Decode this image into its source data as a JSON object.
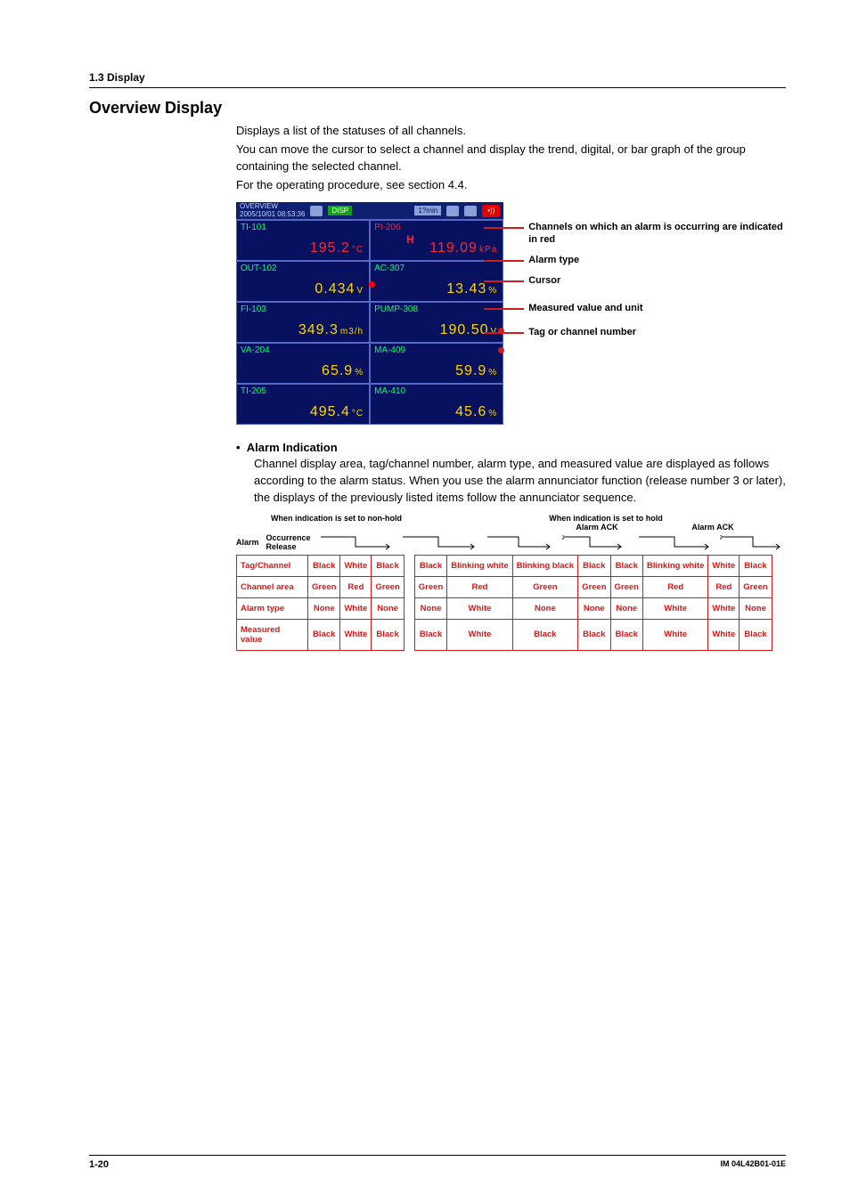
{
  "section": {
    "breadcrumb": "1.3  Display"
  },
  "heading": "Overview Display",
  "intro": {
    "l1": "Displays a list of the statuses of all channels.",
    "l2": "You can move the cursor to select a channel and display the trend, digital, or bar graph of the group containing the selected channel.",
    "l3": "For the operating procedure, see section 4.4."
  },
  "screenshot": {
    "titlebar": {
      "title": "OVERVIEW",
      "datetime": "2005/10/01 08:53:36",
      "disp": "DISP",
      "rate": "1?min"
    },
    "cells": [
      {
        "tag": "TI-101",
        "tag_color": "green",
        "val": "195.2",
        "unit": "°C",
        "val_color": "red"
      },
      {
        "tag": "PI-206",
        "tag_color": "red",
        "alarm_type": "H",
        "val": "119.09",
        "unit": "kPa",
        "val_color": "red"
      },
      {
        "tag": "OUT-102",
        "tag_color": "green",
        "val": "0.434",
        "unit": "V",
        "val_color": "yel"
      },
      {
        "tag": "AC-307",
        "tag_color": "green",
        "val": "13.43",
        "unit": "%",
        "val_color": "yel"
      },
      {
        "tag": "FI-103",
        "tag_color": "green",
        "val": "349.3",
        "unit": "m3/h",
        "val_color": "yel"
      },
      {
        "tag": "PUMP-308",
        "tag_color": "green",
        "val": "190.50",
        "unit": "V",
        "val_color": "yel"
      },
      {
        "tag": "VA-204",
        "tag_color": "green",
        "val": "65.9",
        "unit": "%",
        "val_color": "yel"
      },
      {
        "tag": "MA-409",
        "tag_color": "green",
        "val": "59.9",
        "unit": "%",
        "val_color": "yel"
      },
      {
        "tag": "TI-205",
        "tag_color": "green",
        "val": "495.4",
        "unit": "°C",
        "val_color": "yel"
      },
      {
        "tag": "MA-410",
        "tag_color": "green",
        "val": "45.6",
        "unit": "%",
        "val_color": "yel"
      }
    ]
  },
  "callouts": {
    "c1": "Channels on which an alarm is occurring are indicated in red",
    "c2": "Alarm type",
    "c3": "Cursor",
    "c4": "Measured value and unit",
    "c5": "Tag or channel number"
  },
  "alarm_indication": {
    "heading_bullet": "•",
    "heading": "Alarm Indication",
    "body": "Channel display area, tag/channel number, alarm type, and measured value are displayed as follows according to the alarm status. When you use the alarm annunciator function (release number 3 or later), the displays of the previously listed items follow the annunciator sequence."
  },
  "table": {
    "top1": "When indication is set to non-hold",
    "top2": "When indication is set to hold",
    "sub_ack": "Alarm ACK",
    "state_label": "Alarm",
    "occurrence": "Occurrence",
    "release": "Release",
    "rows": {
      "tag": {
        "label": "Tag/Channel",
        "c1": "Black",
        "c2": "White",
        "c3": "Black",
        "c4": "Black",
        "c5": "Blinking white",
        "c6": "Blinking black",
        "c7": "Black",
        "c8": "Black",
        "c9": "Blinking white",
        "c10": "White",
        "c11": "Black"
      },
      "area": {
        "label": "Channel area",
        "c1": "Green",
        "c2": "Red",
        "c3": "Green",
        "c4": "Green",
        "c5": "Red",
        "c6": "Green",
        "c7": "Green",
        "c8": "Green",
        "c9": "Red",
        "c10": "Red",
        "c11": "Green"
      },
      "atype": {
        "label": "Alarm type",
        "c1": "None",
        "c2": "White",
        "c3": "None",
        "c4": "None",
        "c5": "White",
        "c6": "None",
        "c7": "None",
        "c8": "None",
        "c9": "White",
        "c10": "White",
        "c11": "None"
      },
      "mval": {
        "label": "Measured value",
        "c1": "Black",
        "c2": "White",
        "c3": "Black",
        "c4": "Black",
        "c5": "White",
        "c6": "Black",
        "c7": "Black",
        "c8": "Black",
        "c9": "White",
        "c10": "White",
        "c11": "Black"
      }
    }
  },
  "footer": {
    "page": "1-20",
    "docnum": "IM 04L42B01-01E"
  }
}
